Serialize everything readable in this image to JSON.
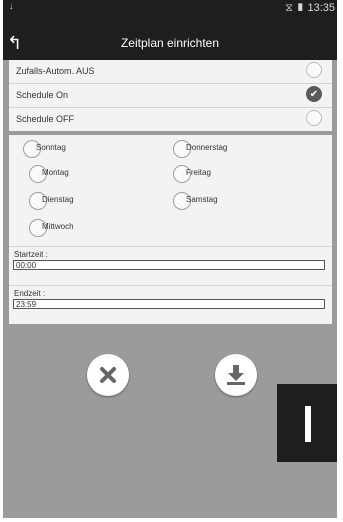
{
  "status": {
    "signal_icon": "signal-icon",
    "battery_icon": "battery-icon",
    "time": "13:35"
  },
  "header": {
    "title": "Zeitplan einrichten"
  },
  "modes": [
    {
      "label": "Zufalls-Autom. AUS",
      "checked": false
    },
    {
      "label": "Schedule On",
      "checked": true
    },
    {
      "label": "Schedule OFF",
      "checked": false
    }
  ],
  "days": {
    "sunday": "Sonntag",
    "monday": "Montag",
    "tuesday": "Dienstag",
    "wednesday": "Mittwoch",
    "thursday": "Donnerstag",
    "friday": "Freitag",
    "saturday": "Samstag"
  },
  "start": {
    "label": "Startzeit :",
    "value": "00:00"
  },
  "end": {
    "label": "Endzeit :",
    "value": "23:59"
  },
  "actions": {
    "cancel_icon": "close-icon",
    "save_icon": "download-icon"
  },
  "colors": {
    "bar": "#1e1e1e",
    "background": "#9b9b9b",
    "panel": "#f3f3f3",
    "checked": "#5b5b5b"
  }
}
